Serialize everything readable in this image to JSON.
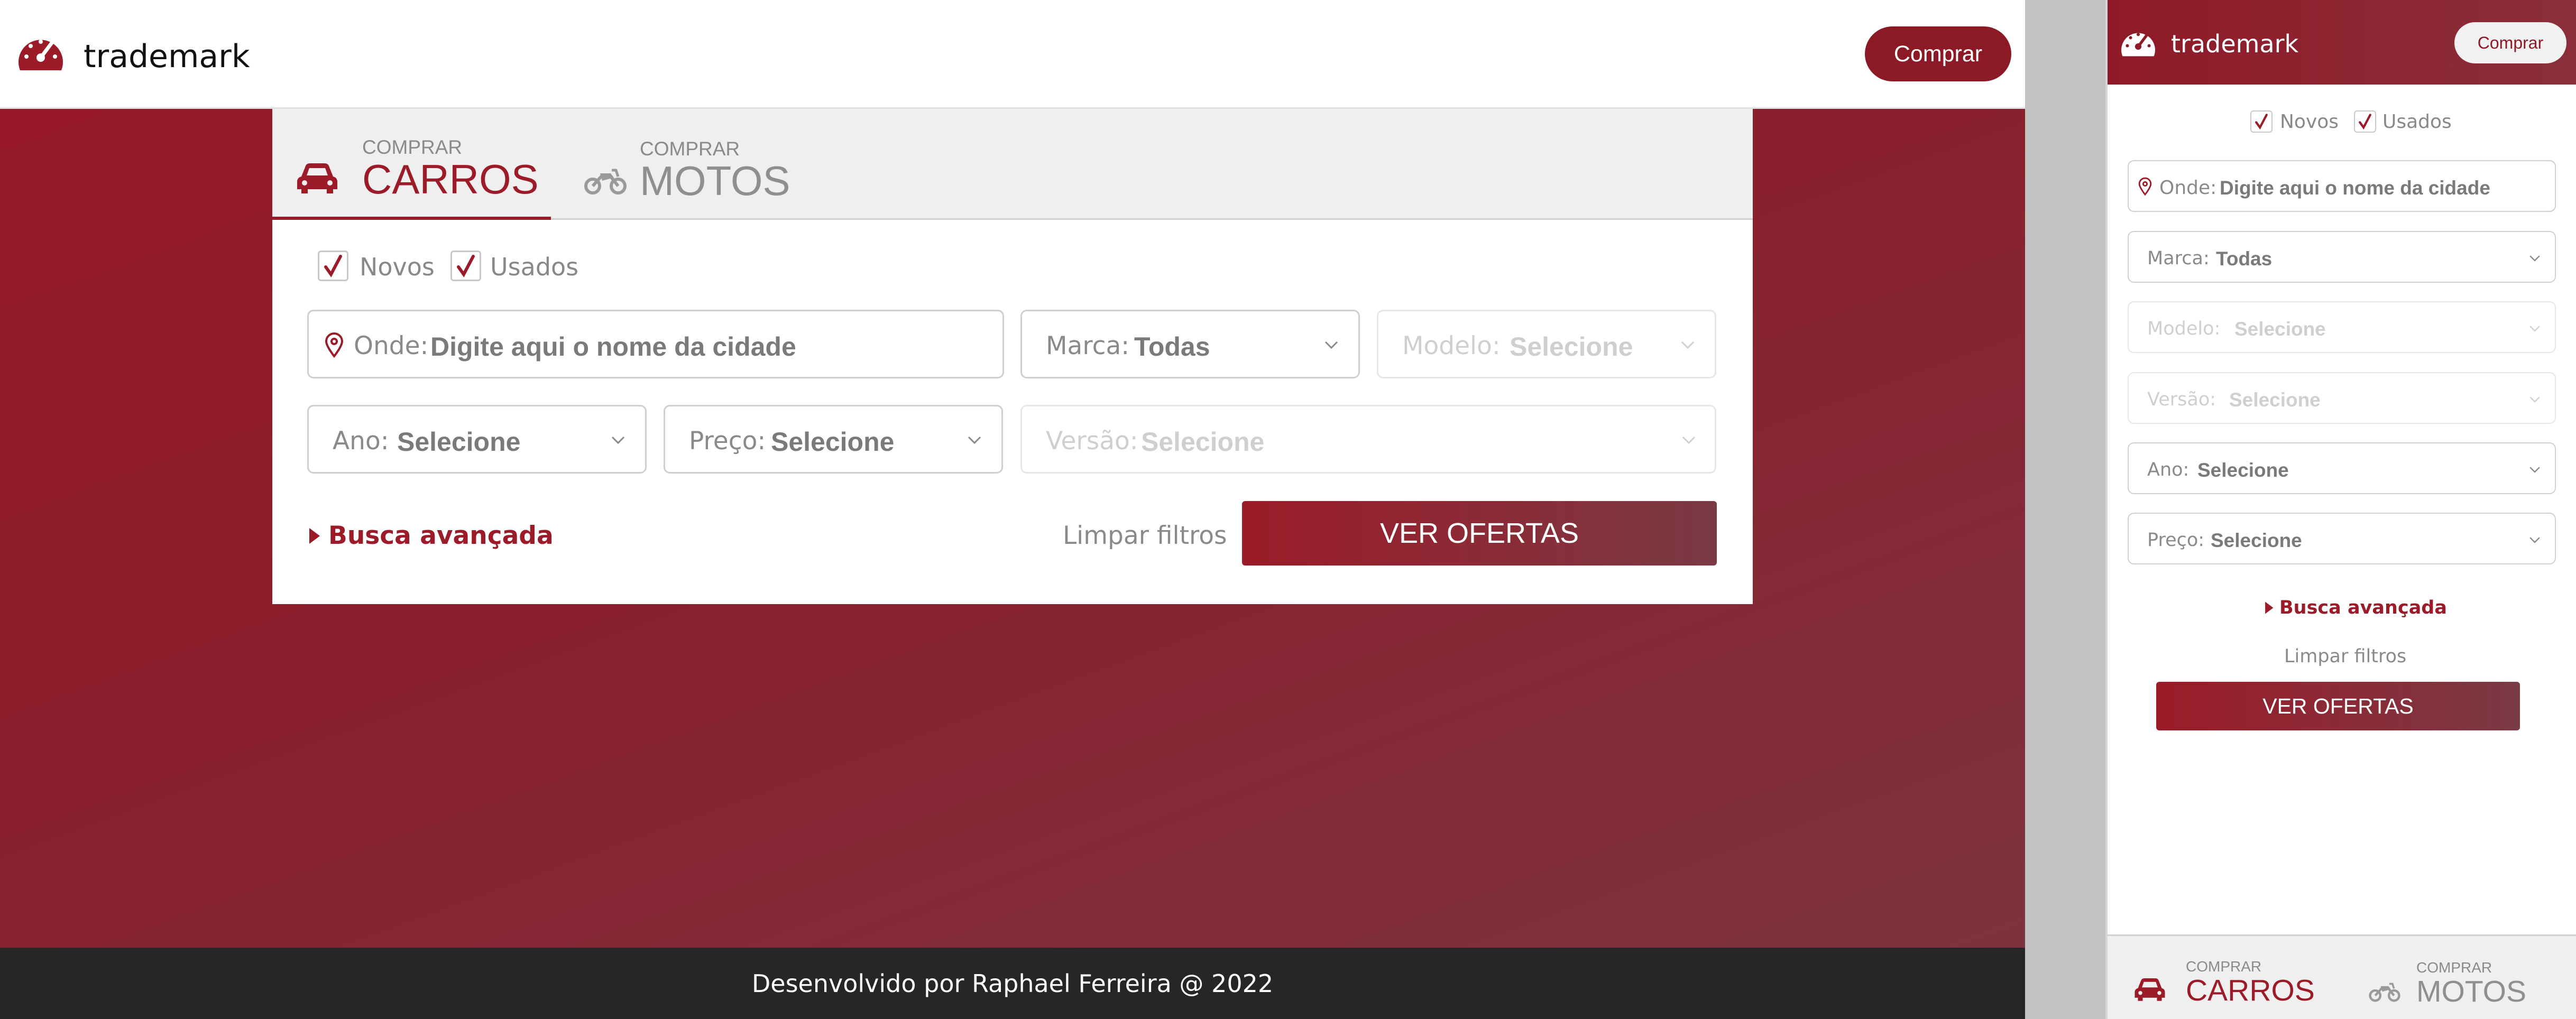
{
  "desktop": {
    "header": {
      "brand": "trademark",
      "buy_button": "Comprar",
      "logo_icon": "speedometer-icon"
    },
    "tabs": [
      {
        "small": "COMPRAR",
        "big": "CARROS",
        "icon": "car-icon",
        "active": true
      },
      {
        "small": "COMPRAR",
        "big": "MOTOS",
        "icon": "motorcycle-icon",
        "active": false
      }
    ],
    "filters": {
      "novos": {
        "label": "Novos",
        "checked": true
      },
      "usados": {
        "label": "Usados",
        "checked": true
      }
    },
    "fields": {
      "onde": {
        "label": "Onde:",
        "placeholder": "Digite aqui o nome da cidade",
        "icon": "location-pin-icon"
      },
      "marca": {
        "label": "Marca:",
        "value": "Todas"
      },
      "modelo": {
        "label": "Modelo:",
        "value": "Selecione",
        "disabled": true
      },
      "ano": {
        "label": "Ano:",
        "value": "Selecione"
      },
      "preco": {
        "label": "Preço:",
        "value": "Selecione"
      },
      "versao": {
        "label": "Versão:",
        "value": "Selecione",
        "disabled": true
      }
    },
    "advanced_search": "Busca avançada",
    "clear_filters": "Limpar filtros",
    "submit": "VER OFERTAS",
    "footer": "Desenvolvido por Raphael Ferreira @ 2022"
  },
  "mobile": {
    "header": {
      "brand": "trademark",
      "buy_button": "Comprar"
    },
    "filters": {
      "novos": "Novos",
      "usados": "Usados"
    },
    "fields": {
      "onde": {
        "label": "Onde:",
        "placeholder": "Digite aqui o nome da cidade"
      },
      "marca": {
        "label": "Marca:",
        "value": "Todas"
      },
      "modelo": {
        "label": "Modelo:",
        "value": "Selecione",
        "disabled": true
      },
      "versao": {
        "label": "Versão:",
        "value": "Selecione",
        "disabled": true
      },
      "ano": {
        "label": "Ano:",
        "value": "Selecione"
      },
      "preco": {
        "label": "Preço:",
        "value": "Selecione"
      }
    },
    "advanced_search": "Busca avançada",
    "clear_filters": "Limpar filtros",
    "submit": "VER OFERTAS",
    "tabs": [
      {
        "small": "COMPRAR",
        "big": "CARROS",
        "active": true
      },
      {
        "small": "COMPRAR",
        "big": "MOTOS",
        "active": false
      }
    ]
  },
  "colors": {
    "brand_red": "#9b1b28",
    "footer_dark": "#262626",
    "muted_text": "#8a8a8a"
  }
}
